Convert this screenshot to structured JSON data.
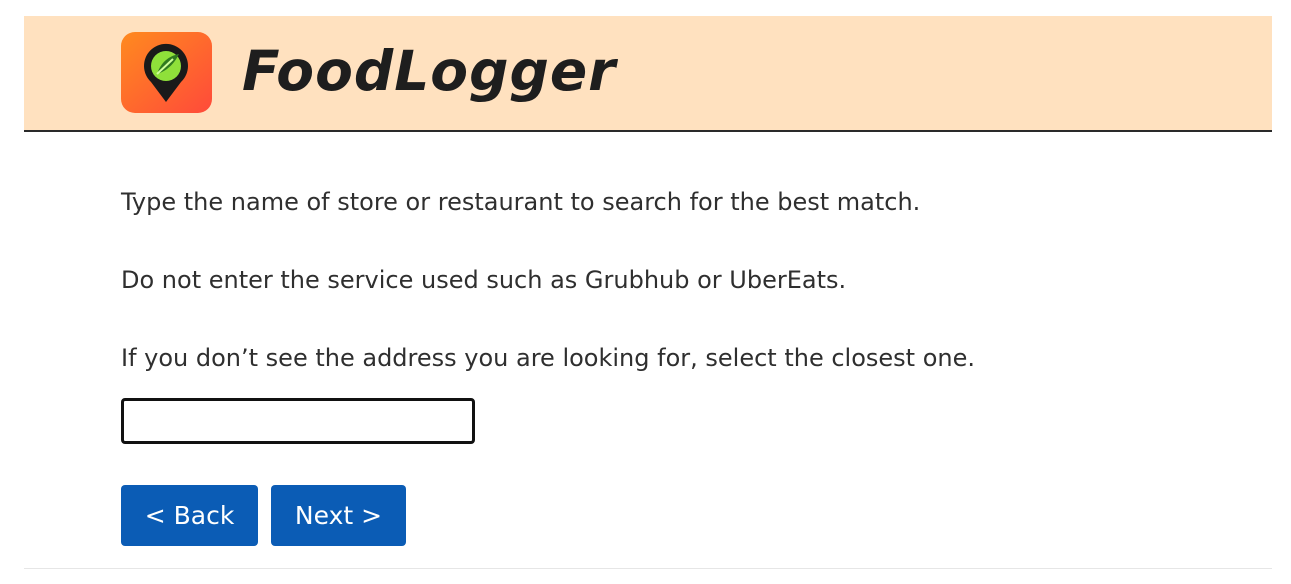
{
  "app": {
    "name": "FoodLogger"
  },
  "instructions": {
    "line1": "Type the name of store or restaurant to search for the best match.",
    "line2": "Do not enter the service used such as Grubhub or UberEats.",
    "line3": "If you don’t see the address you are looking for, select the closest one."
  },
  "search": {
    "value": "",
    "placeholder": ""
  },
  "buttons": {
    "back": "< Back",
    "next": "Next >"
  },
  "colors": {
    "header_bg": "#ffe1bf",
    "primary_button": "#0b5cb5",
    "logo_orange": "#ff6a2a",
    "logo_green": "#7bd42a"
  },
  "icons": {
    "logo": "map-pin-leaf-icon"
  }
}
